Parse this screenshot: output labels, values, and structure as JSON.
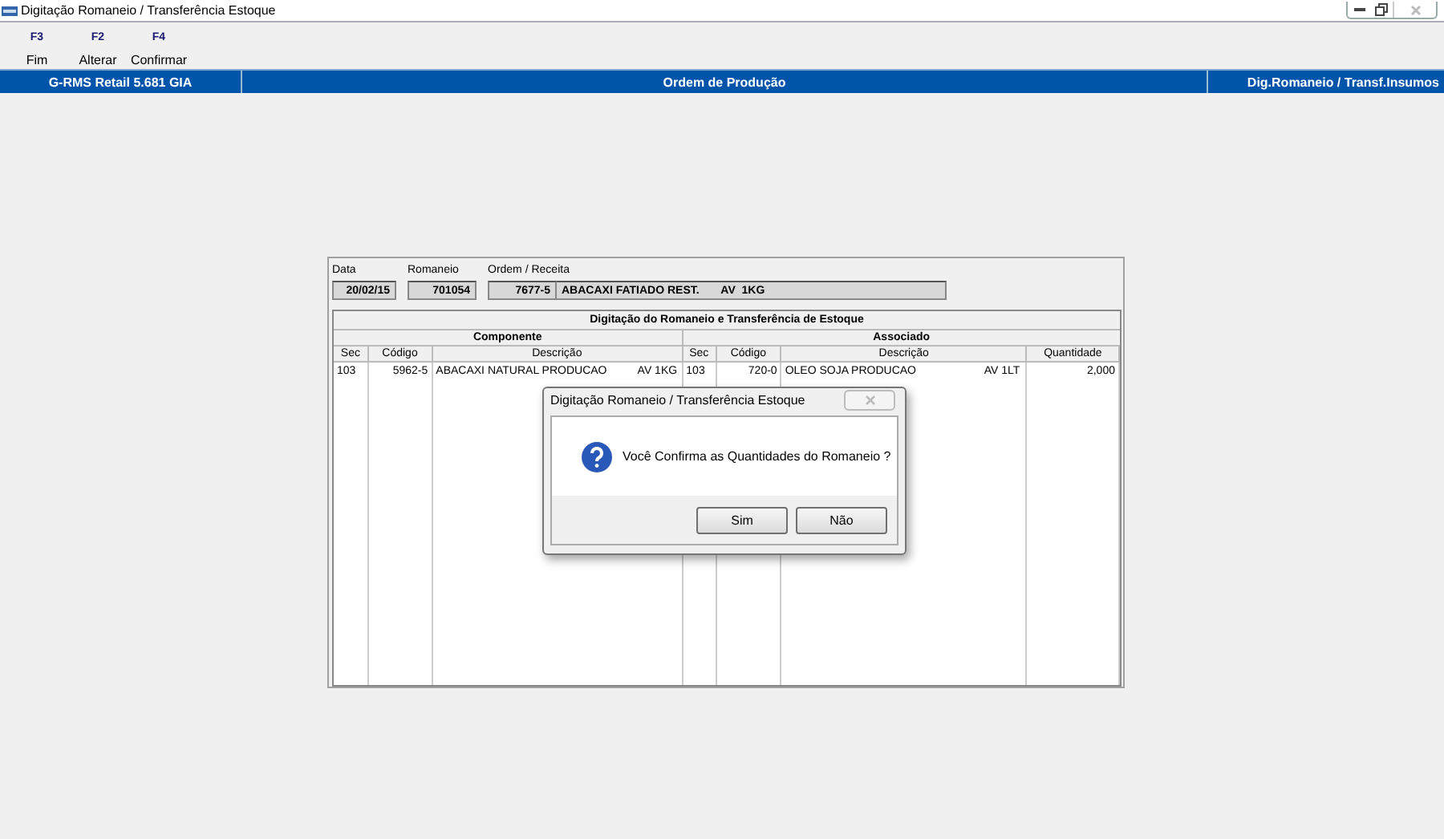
{
  "window": {
    "title": "Digitação Romaneio / Transferência Estoque"
  },
  "toolbar": [
    {
      "key": "F3",
      "label": "Fim"
    },
    {
      "key": "F2",
      "label": "Alterar"
    },
    {
      "key": "F4",
      "label": "Confirmar"
    }
  ],
  "header_bar": {
    "left": "G-RMS Retail 5.681 GIA",
    "center": "Ordem de Produção",
    "right": "Dig.Romaneio / Transf.Insumos"
  },
  "form": {
    "fields": [
      {
        "label": "Data",
        "value": "20/02/15"
      },
      {
        "label": "Romaneio",
        "value": "701054"
      },
      {
        "label": "Ordem / Receita",
        "value": "7677-5",
        "description": "ABACAXI FATIADO REST.       AV  1KG"
      }
    ]
  },
  "table": {
    "title": "Digitação do Romaneio e Transferência de Estoque",
    "groups": [
      "Componente",
      "Associado"
    ],
    "columns": [
      "Sec",
      "Código",
      "Descrição",
      "Sec",
      "Código",
      "Descrição",
      "Quantidade"
    ],
    "rows": [
      {
        "cells": [
          "103",
          "5962-5",
          "ABACAXI NATURAL PRODUCAO          AV 1KG",
          "103",
          "720-0",
          "OLEO SOJA PRODUCAO                      AV 1LT",
          "2,000"
        ]
      }
    ]
  },
  "dialog": {
    "title": "Digitação Romaneio / Transferência Estoque",
    "message": "Você Confirma as Quantidades do Romaneio ?",
    "buttons": [
      "Sim",
      "Não"
    ]
  }
}
